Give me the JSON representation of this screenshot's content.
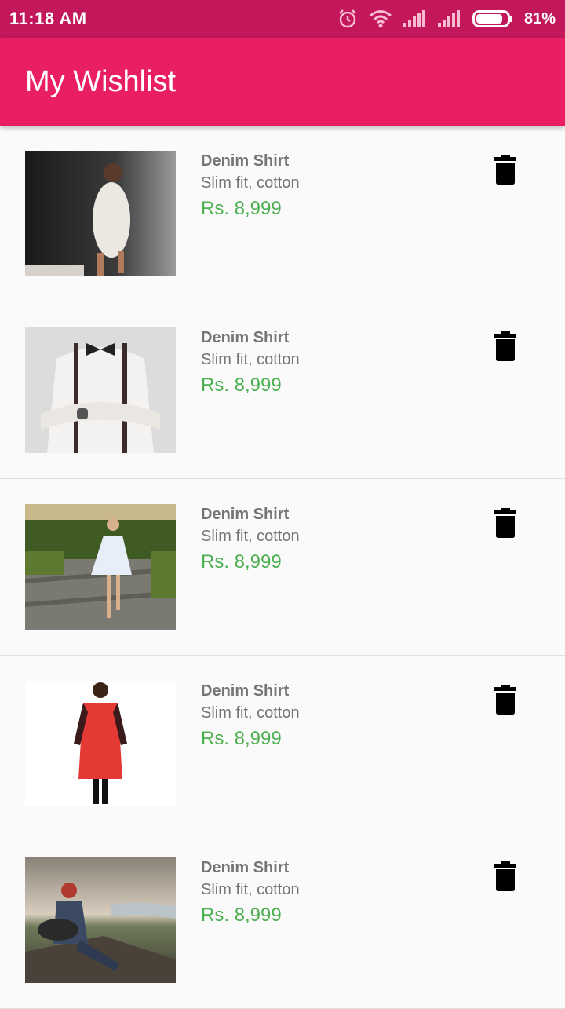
{
  "status_bar": {
    "time": "11:18 AM",
    "battery": "81%"
  },
  "app_bar": {
    "title": "My Wishlist"
  },
  "items": [
    {
      "name": "Denim Shirt",
      "description": "Slim fit, cotton",
      "price": "Rs. 8,999"
    },
    {
      "name": "Denim Shirt",
      "description": "Slim fit, cotton",
      "price": "Rs. 8,999"
    },
    {
      "name": "Denim Shirt",
      "description": "Slim fit, cotton",
      "price": "Rs. 8,999"
    },
    {
      "name": "Denim Shirt",
      "description": "Slim fit, cotton",
      "price": "Rs. 8,999"
    },
    {
      "name": "Denim Shirt",
      "description": "Slim fit, cotton",
      "price": "Rs. 8,999"
    }
  ],
  "icons": [
    "alarm-icon",
    "wifi-icon",
    "signal-icon",
    "battery-icon",
    "delete-icon"
  ],
  "colors": {
    "status_bar": "#c2185b",
    "app_bar": "#e91e63",
    "price": "#4caf50",
    "text_secondary": "#757575"
  }
}
